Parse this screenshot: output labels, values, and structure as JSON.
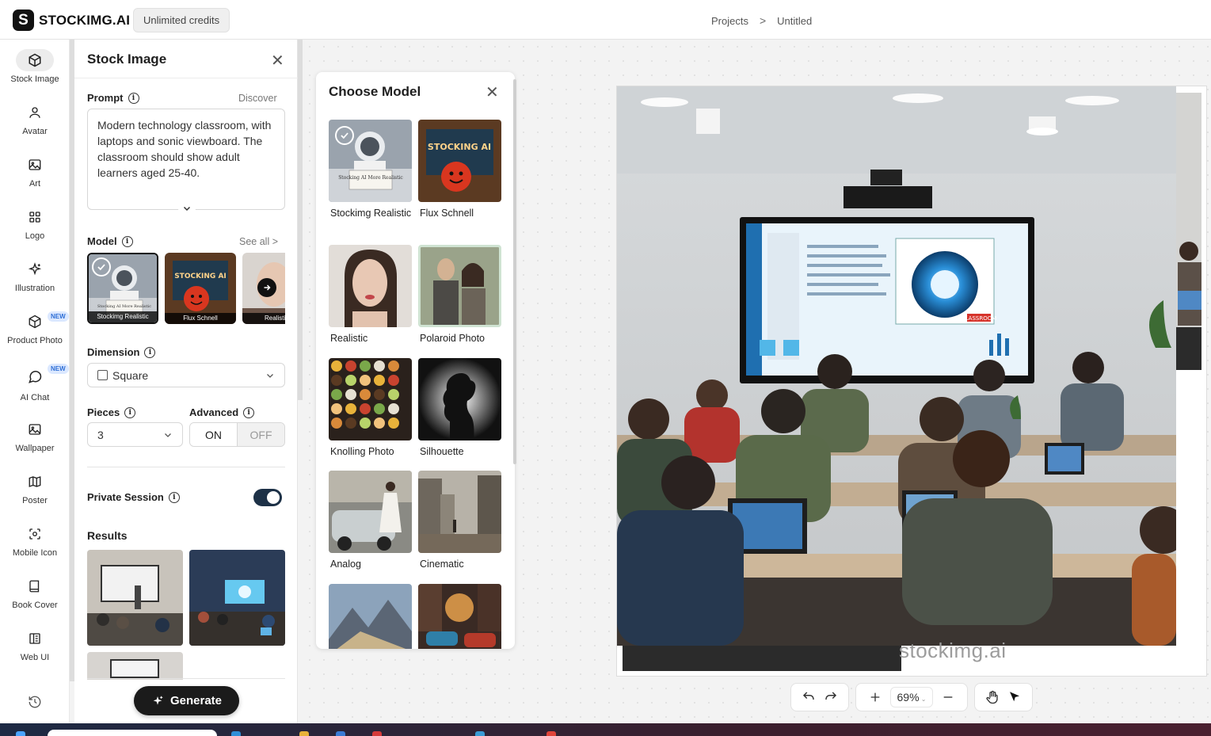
{
  "app": {
    "logo_letter": "S",
    "name": "STOCKIMG.AI",
    "credits": "Unlimited credits"
  },
  "breadcrumb": {
    "projects": "Projects",
    "separator": ">",
    "current": "Untitled"
  },
  "rail": {
    "items": [
      {
        "label": "Stock Image",
        "icon": "cube-icon"
      },
      {
        "label": "Avatar",
        "icon": "user-icon"
      },
      {
        "label": "Art",
        "icon": "image-icon"
      },
      {
        "label": "Logo",
        "icon": "grid-icon"
      },
      {
        "label": "Illustration",
        "icon": "sparkle-icon"
      },
      {
        "label": "Product Photo",
        "icon": "box-icon",
        "badge": "NEW"
      },
      {
        "label": "AI Chat",
        "icon": "chat-icon",
        "badge": "NEW"
      },
      {
        "label": "Wallpaper",
        "icon": "image-icon"
      },
      {
        "label": "Poster",
        "icon": "map-icon"
      },
      {
        "label": "Mobile Icon",
        "icon": "app-icon"
      },
      {
        "label": "Book Cover",
        "icon": "book-icon"
      },
      {
        "label": "Web UI",
        "icon": "layout-icon"
      }
    ],
    "history_icon": "history-icon"
  },
  "panel": {
    "title": "Stock Image",
    "prompt_label": "Prompt",
    "discover": "Discover",
    "prompt_text": "Modern technology classroom, with laptops and sonic viewboard. The classroom should show adult learners aged 25-40.",
    "model_label": "Model",
    "see_all": "See all >",
    "model_thumbs": [
      "Stockimg Realistic",
      "Flux Schnell",
      "Realisti"
    ],
    "thumb_text": {
      "a": "Stocking AI More Realistic",
      "b": "STOCKING AI"
    },
    "dimension_label": "Dimension",
    "dimension_value": "Square",
    "pieces_label": "Pieces",
    "pieces_value": "3",
    "advanced_label": "Advanced",
    "advanced_on": "ON",
    "advanced_off": "OFF",
    "private_label": "Private Session",
    "private_on": true,
    "results_label": "Results",
    "generate": "Generate"
  },
  "chooser": {
    "title": "Choose Model",
    "models": [
      {
        "name": "Stockimg Realistic",
        "selected": true
      },
      {
        "name": "Flux Schnell"
      },
      {
        "name": "Realistic"
      },
      {
        "name": "Polaroid Photo"
      },
      {
        "name": "Knolling Photo"
      },
      {
        "name": "Silhouette"
      },
      {
        "name": "Analog"
      },
      {
        "name": "Cinematic"
      },
      {
        "name": ""
      },
      {
        "name": ""
      }
    ]
  },
  "canvas": {
    "watermark": "stockimg.ai",
    "zoom": "69%",
    "screen_badge": "CLASSROOM"
  },
  "colors": {
    "accent": "#1b1b1b",
    "toggle": "#1d3147",
    "badge": "#dbe8ff"
  }
}
